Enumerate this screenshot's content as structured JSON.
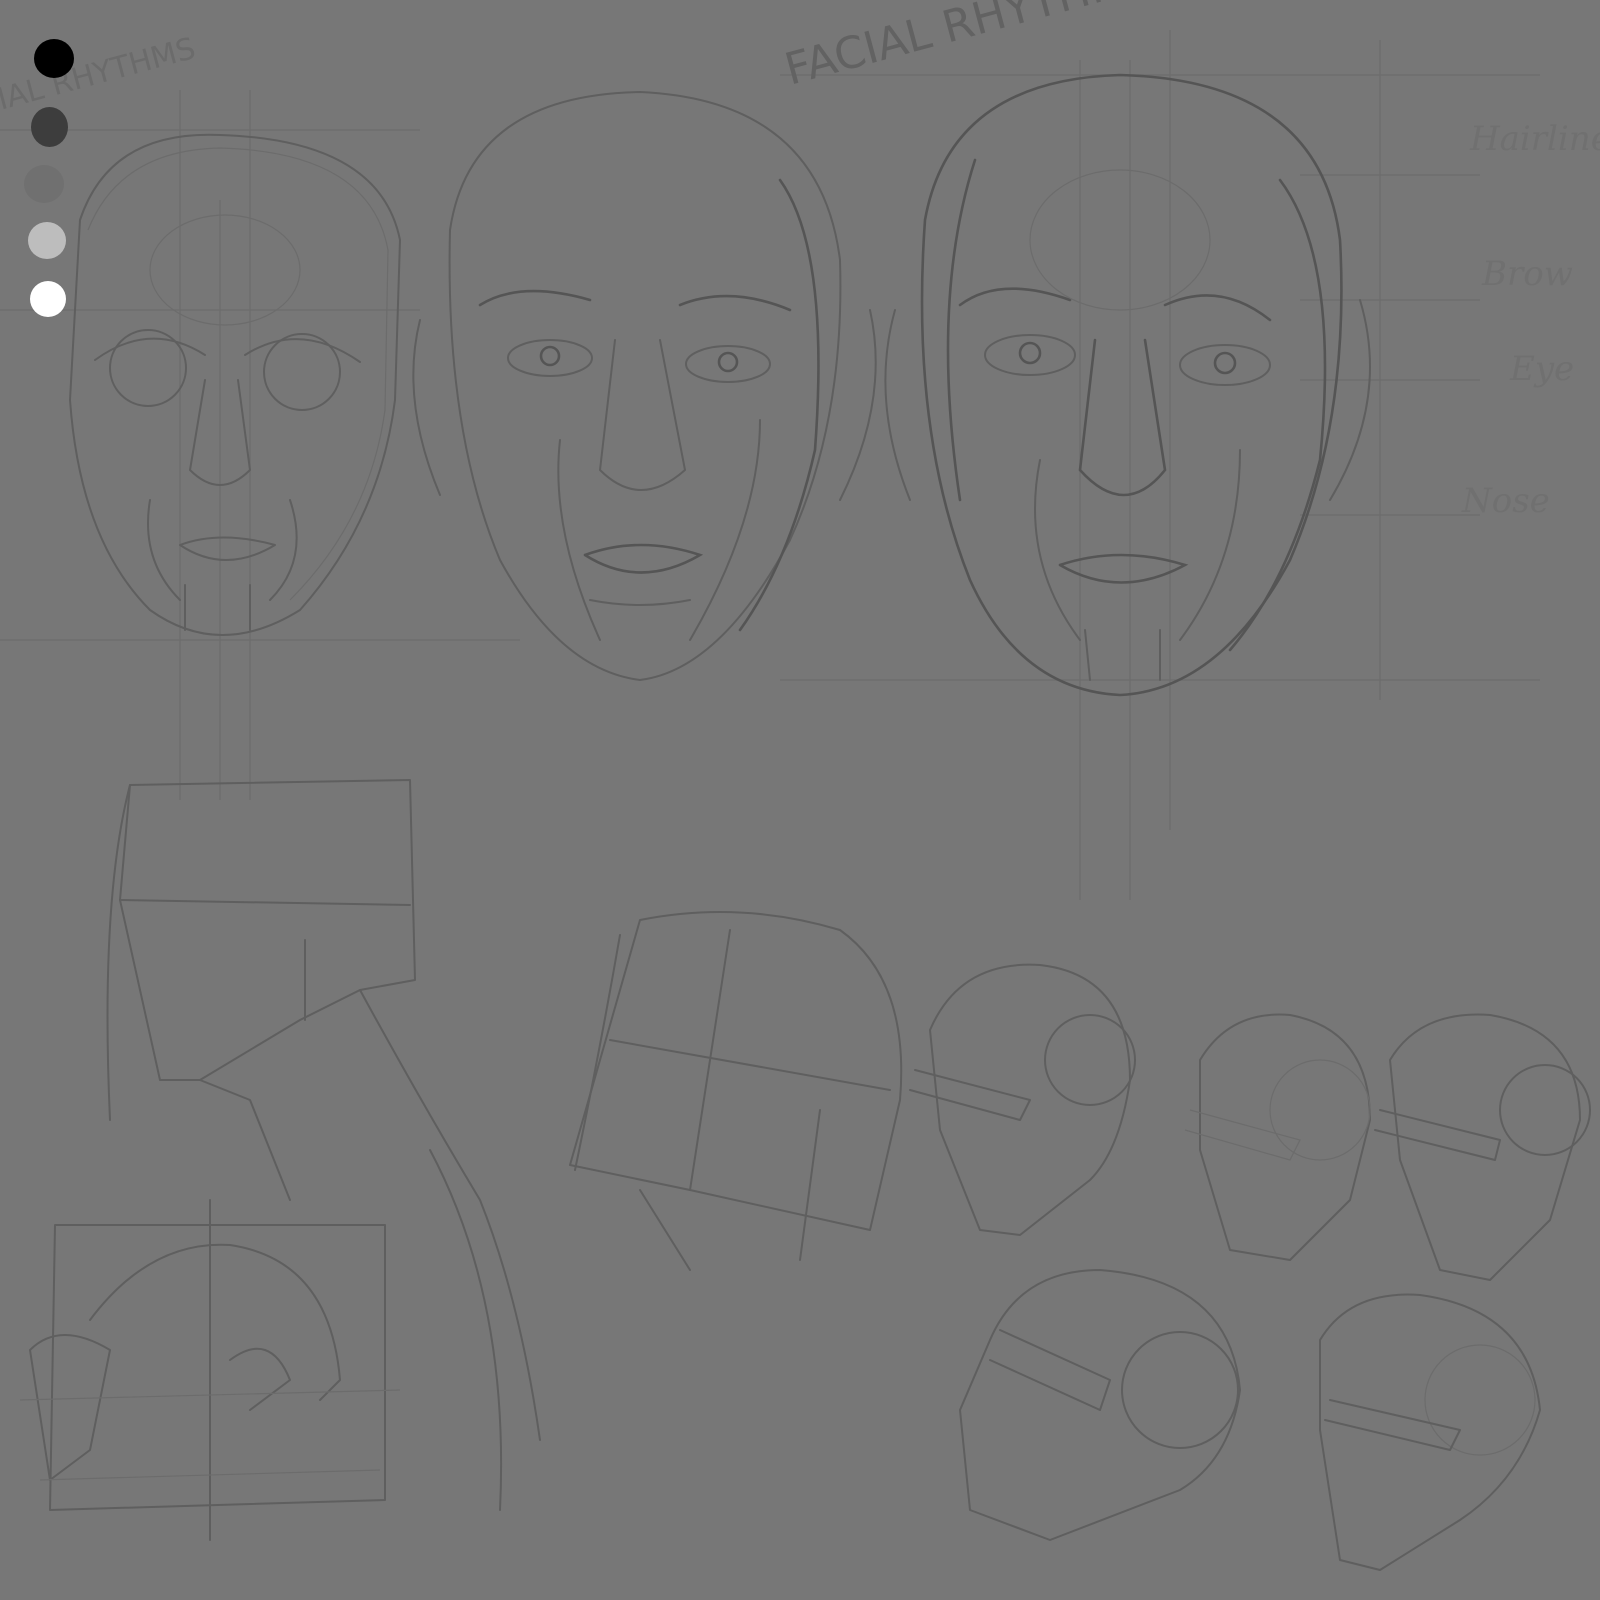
{
  "title": "FACIAL RHYTHMS",
  "title_partial_left": "ACIAL RHYTHMS",
  "proportion_labels": [
    "Hairline",
    "Brow",
    "Eye",
    "Nose"
  ],
  "palette": [
    {
      "name": "black",
      "color": "#000000"
    },
    {
      "name": "dark-gray",
      "color": "#3d3d3d"
    },
    {
      "name": "mid-gray",
      "color": "#707070"
    },
    {
      "name": "light-gray",
      "color": "#bdbdbd"
    },
    {
      "name": "white",
      "color": "#ffffff"
    }
  ],
  "background_color": "#777777"
}
